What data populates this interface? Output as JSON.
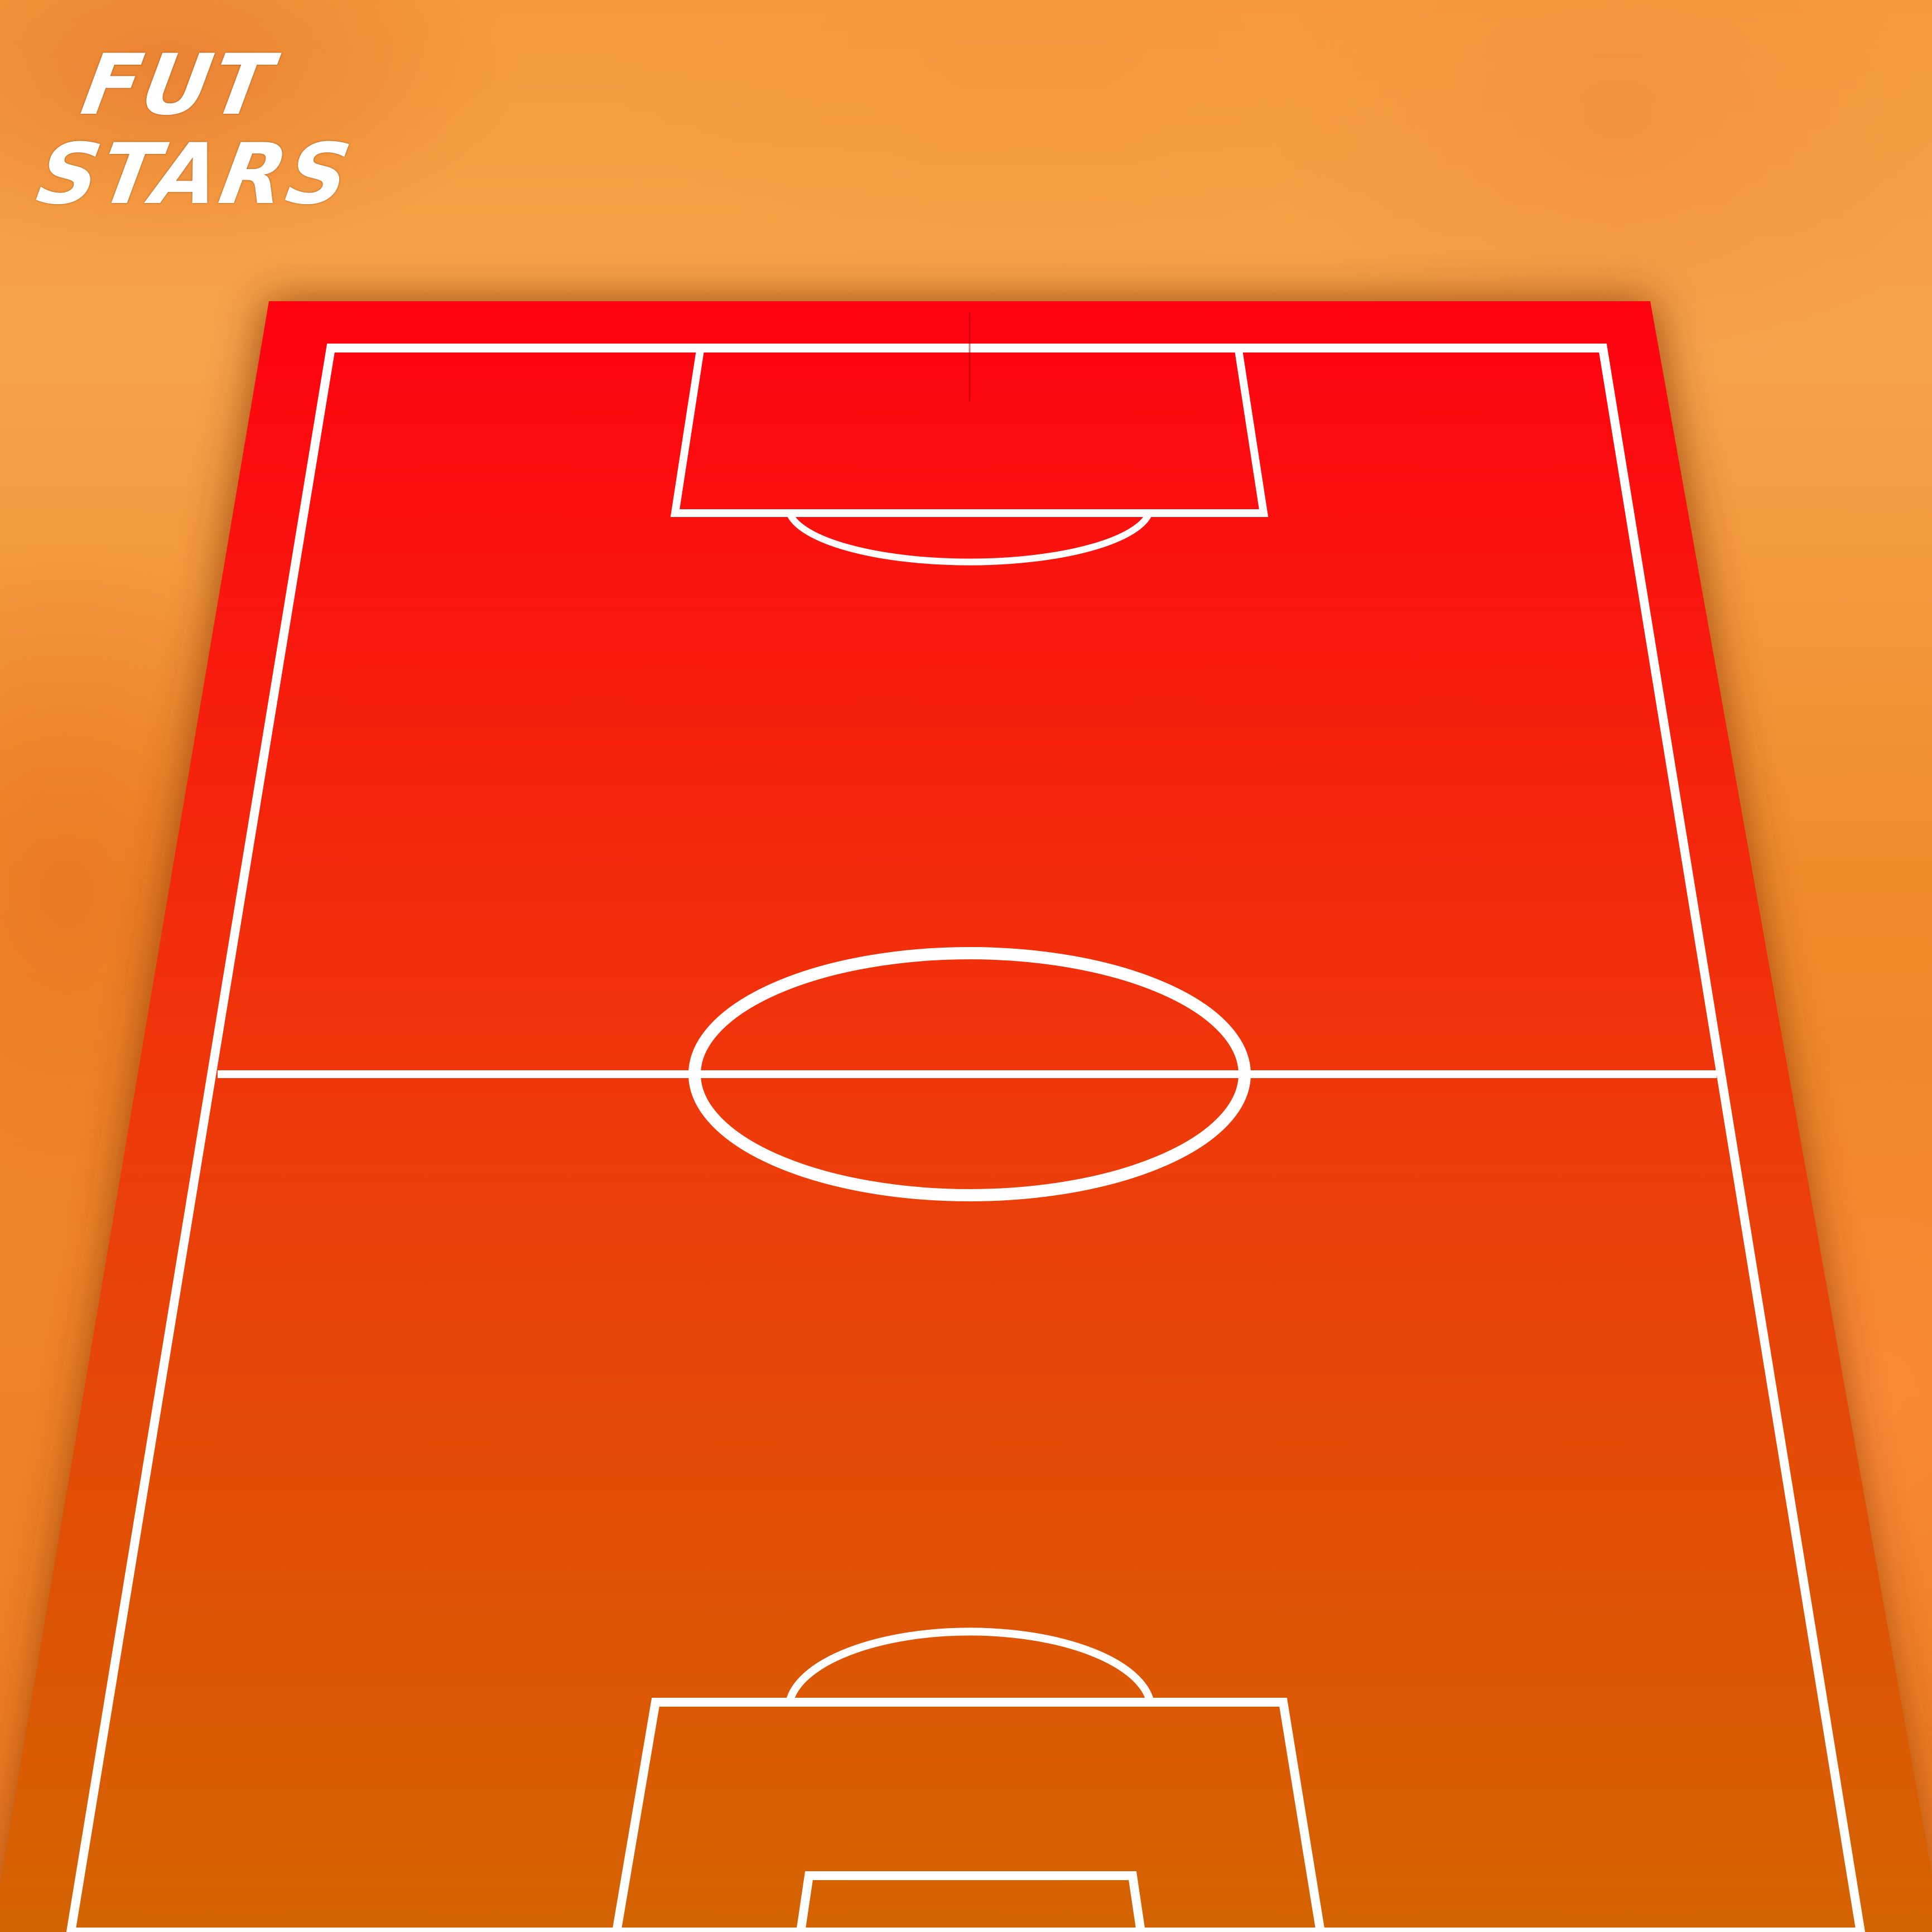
{
  "logo": {
    "line1": "FUT",
    "line2": "STARS"
  },
  "colors": {
    "field_top": "#ff0210",
    "field_bottom": "#d46402",
    "lines": "#ffffff",
    "background": "#f39437"
  }
}
